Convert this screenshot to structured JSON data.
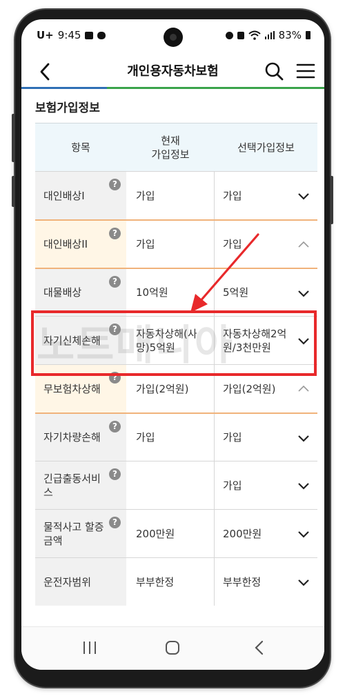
{
  "status": {
    "carrier": "U+",
    "time": "9:45",
    "battery": "83%"
  },
  "header": {
    "title": "개인용자동차보험"
  },
  "section": {
    "title": "보험가입정보"
  },
  "table": {
    "columns": {
      "item": "항목",
      "current_line1": "현재",
      "current_line2": "가입정보",
      "select": "선택가입정보"
    },
    "rows": [
      {
        "name": "대인배상I",
        "current": "가입",
        "selected": "가입",
        "expanded": false
      },
      {
        "name": "대인배상II",
        "current": "가입",
        "selected": "가입",
        "expanded": true
      },
      {
        "name": "대물배상",
        "current": "10억원",
        "selected": "5억원",
        "expanded": false
      },
      {
        "name": "자기신체손해",
        "current": "자동차상해(사망)5억원",
        "selected": "자동차상해2억원/3천만원",
        "expanded": false
      },
      {
        "name": "무보험차상해",
        "current": "가입(2억원)",
        "selected": "가입(2억원)",
        "expanded": true
      },
      {
        "name": "자기차량손해",
        "current": "가입",
        "selected": "가입",
        "expanded": false
      },
      {
        "name": "긴급출동서비스",
        "current": "",
        "selected": "가입",
        "expanded": false
      },
      {
        "name": "물적사고 할증금액",
        "current": "200만원",
        "selected": "200만원",
        "expanded": false
      },
      {
        "name": "운전자범위",
        "current": "부부한정",
        "selected": "부부한정",
        "expanded": false
      }
    ]
  },
  "watermark": "노트매니아",
  "colors": {
    "highlight": "#e8292b",
    "accent_blue": "#2f6fb5",
    "accent_green": "#3aa34a",
    "orange_rule": "#f0b27a"
  }
}
